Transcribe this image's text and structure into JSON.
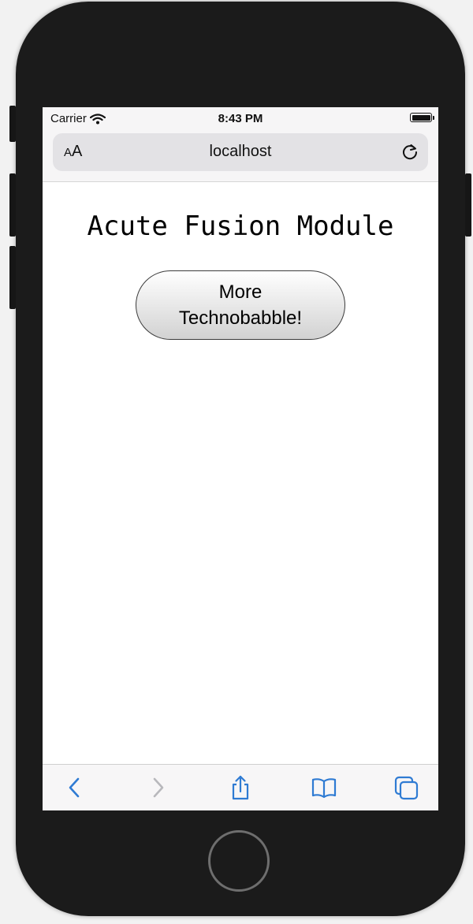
{
  "status_bar": {
    "carrier": "Carrier",
    "time": "8:43 PM"
  },
  "browser": {
    "text_size_big": "A",
    "text_size_small": "A",
    "url": "localhost"
  },
  "page": {
    "heading": "Acute Fusion Module",
    "button_line1": "More",
    "button_line2": "Technobabble!"
  },
  "colors": {
    "accent": "#2f7bd3",
    "disabled": "#b8b8bc"
  },
  "toolbar": {
    "back": "chevron-left-icon",
    "forward": "chevron-right-icon",
    "share": "share-icon",
    "bookmarks": "book-icon",
    "tabs": "tabs-icon"
  }
}
